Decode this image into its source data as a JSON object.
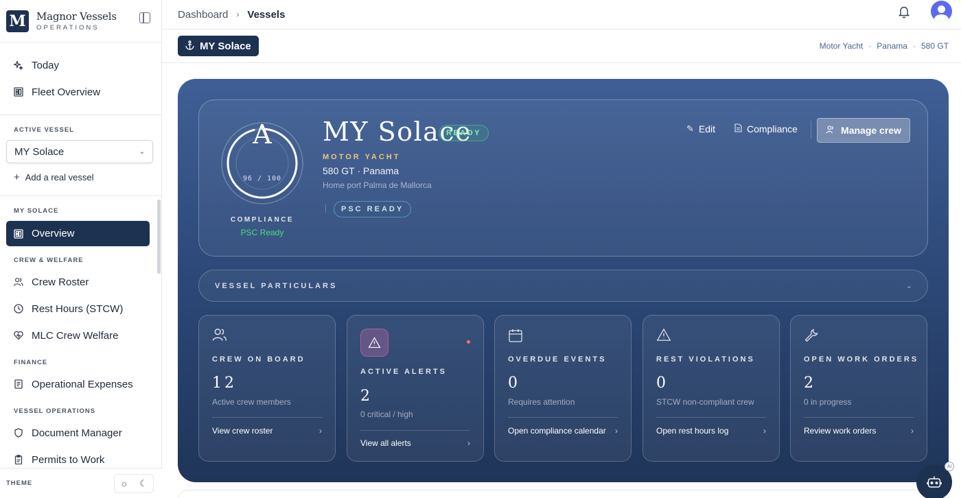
{
  "brand": {
    "name": "Magnor Vessels",
    "sub": "OPERATIONS",
    "logo_letter": "M",
    "color": "#1d3150"
  },
  "sidebar": {
    "top_items": [
      {
        "label": "Today",
        "icon": "sparkle-icon"
      },
      {
        "label": "Fleet Overview",
        "icon": "grid-icon"
      }
    ],
    "active_vessel_label": "ACTIVE VESSEL",
    "active_vessel_value": "MY Solace",
    "add_vessel": "Add a real vessel",
    "vessel_section": "MY SOLACE",
    "overview": "Overview",
    "crew_section": "CREW & WELFARE",
    "crew_items": [
      {
        "label": "Crew Roster",
        "icon": "users-icon"
      },
      {
        "label": "Rest Hours (STCW)",
        "icon": "clock-icon"
      },
      {
        "label": "MLC Crew Welfare",
        "icon": "heart-icon"
      }
    ],
    "finance_section": "FINANCE",
    "finance_items": [
      {
        "label": "Operational Expenses",
        "icon": "receipt-icon"
      }
    ],
    "ops_section": "VESSEL OPERATIONS",
    "ops_items": [
      {
        "label": "Document Manager",
        "icon": "shield-icon"
      },
      {
        "label": "Permits to Work",
        "icon": "clipboard-icon"
      }
    ],
    "theme_label": "THEME"
  },
  "breadcrumb": {
    "root": "Dashboard",
    "current": "Vessels"
  },
  "subbar": {
    "vessel": "MY Solace",
    "meta": [
      "Motor Yacht",
      "Panama",
      "580 GT"
    ]
  },
  "hero": {
    "gauge_letter": "A",
    "gauge_score": "96 / 100",
    "gauge_value": 0.96,
    "compliance_label": "COMPLIANCE",
    "compliance_status": "PSC Ready",
    "title": "MY Solace",
    "ready_badge": "READY",
    "type": "MOTOR YACHT",
    "line": "580 GT · Panama",
    "home_port": "Home port Palma de Mallorca",
    "psc_badge": "PSC READY",
    "actions": {
      "edit": "Edit",
      "compliance": "Compliance",
      "manage_crew": "Manage crew"
    },
    "particulars": "VESSEL PARTICULARS"
  },
  "cards": [
    {
      "label": "CREW ON BOARD",
      "value": "12",
      "sub": "Active crew members",
      "link": "View crew roster"
    },
    {
      "label": "ACTIVE ALERTS",
      "value": "2",
      "sub": "0 critical / high",
      "link": "View all alerts"
    },
    {
      "label": "OVERDUE EVENTS",
      "value": "0",
      "sub": "Requires attention",
      "link": "Open compliance calendar"
    },
    {
      "label": "REST VIOLATIONS",
      "value": "0",
      "sub": "STCW non-compliant crew",
      "link": "Open rest hours log"
    },
    {
      "label": "OPEN WORK ORDERS",
      "value": "2",
      "sub": "0 in progress",
      "link": "Review work orders"
    }
  ],
  "fab_badge": "AI"
}
